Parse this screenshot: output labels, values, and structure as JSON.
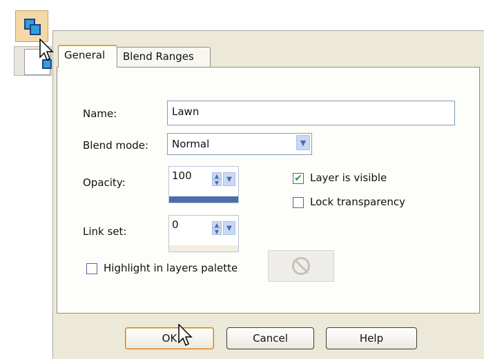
{
  "dialog": {
    "tabs": [
      {
        "label": "General",
        "active": true
      },
      {
        "label": "Blend Ranges",
        "active": false
      }
    ],
    "name_label": "Name:",
    "name_value": "Lawn",
    "blend_mode_label": "Blend mode:",
    "blend_mode_value": "Normal",
    "opacity_label": "Opacity:",
    "opacity_value": "100",
    "opacity_percent": 100,
    "link_set_label": "Link set:",
    "link_set_value": "0",
    "layer_visible_label": "Layer is visible",
    "layer_visible_checked": true,
    "lock_transparency_label": "Lock transparency",
    "lock_transparency_checked": false,
    "highlight_label": "Highlight in layers palette",
    "highlight_checked": false,
    "buttons": {
      "ok": "OK",
      "cancel": "Cancel",
      "help": "Help"
    }
  },
  "colors": {
    "dialog_bg": "#ece9d8",
    "panel_bg": "#fdfdfa",
    "accent": "#e8a43a",
    "checkmark": "#2a9a2a",
    "slider_fill": "#4a6ea8"
  },
  "icons": [
    "layer-icon",
    "mouse-pointer-icon",
    "no-entry-icon",
    "dropdown-arrow-icon",
    "spin-arrows-icon",
    "check-icon"
  ]
}
